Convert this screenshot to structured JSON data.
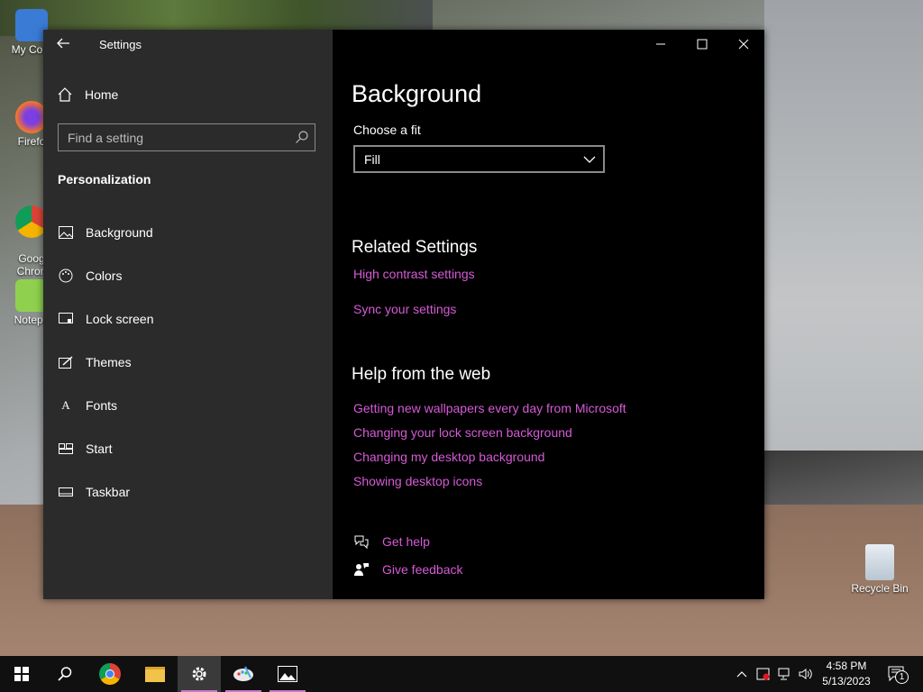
{
  "desktop": {
    "icons": [
      {
        "label": "My Com"
      },
      {
        "label": "Firefo"
      },
      {
        "label": "Goog\nChron"
      },
      {
        "label": "Notepa"
      },
      {
        "label": "Recycle Bin"
      }
    ]
  },
  "window": {
    "title": "Settings"
  },
  "nav": {
    "home_label": "Home",
    "search_placeholder": "Find a setting",
    "section_title": "Personalization",
    "items": [
      {
        "label": "Background",
        "icon": "picture-icon"
      },
      {
        "label": "Colors",
        "icon": "palette-icon"
      },
      {
        "label": "Lock screen",
        "icon": "lock-screen-icon"
      },
      {
        "label": "Themes",
        "icon": "themes-icon"
      },
      {
        "label": "Fonts",
        "icon": "fonts-icon"
      },
      {
        "label": "Start",
        "icon": "start-icon"
      },
      {
        "label": "Taskbar",
        "icon": "taskbar-icon"
      }
    ]
  },
  "content": {
    "title": "Background",
    "fit_label": "Choose a fit",
    "fit_value": "Fill",
    "related_title": "Related Settings",
    "related_links": [
      "High contrast settings",
      "Sync your settings"
    ],
    "help_title": "Help from the web",
    "help_links": [
      "Getting new wallpapers every day from Microsoft",
      "Changing your lock screen background",
      "Changing my desktop background",
      "Showing desktop icons"
    ],
    "get_help": "Get help",
    "give_feedback": "Give feedback"
  },
  "taskbar": {
    "time": "4:58 PM",
    "date": "5/13/2023",
    "notification_count": "1"
  },
  "colors": {
    "accent": "#d65ad6",
    "nav_bg": "#2b2b2b",
    "content_bg": "#000000"
  }
}
